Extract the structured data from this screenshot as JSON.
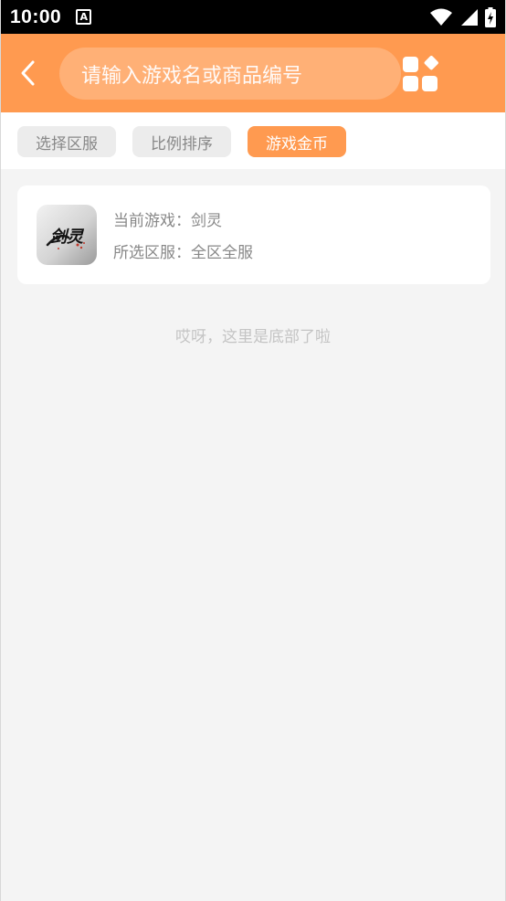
{
  "status_bar": {
    "time": "10:00",
    "notification_icon": "a-icon"
  },
  "header": {
    "back_icon": "chevron-left-icon",
    "search_placeholder": "请输入游戏名或商品编号",
    "menu_icon": "grid-icon"
  },
  "filters": [
    {
      "label": "选择区服",
      "active": false
    },
    {
      "label": "比例排序",
      "active": false
    },
    {
      "label": "游戏金币",
      "active": true
    }
  ],
  "game_card": {
    "logo_text": "剑灵",
    "current_game_label": "当前游戏：",
    "current_game": "剑灵",
    "server_label": "所选区服：",
    "server": "全区全服"
  },
  "footer_text": "哎呀，这里是底部了啦",
  "colors": {
    "accent": "#ff9a50",
    "background": "#f4f4f4"
  }
}
